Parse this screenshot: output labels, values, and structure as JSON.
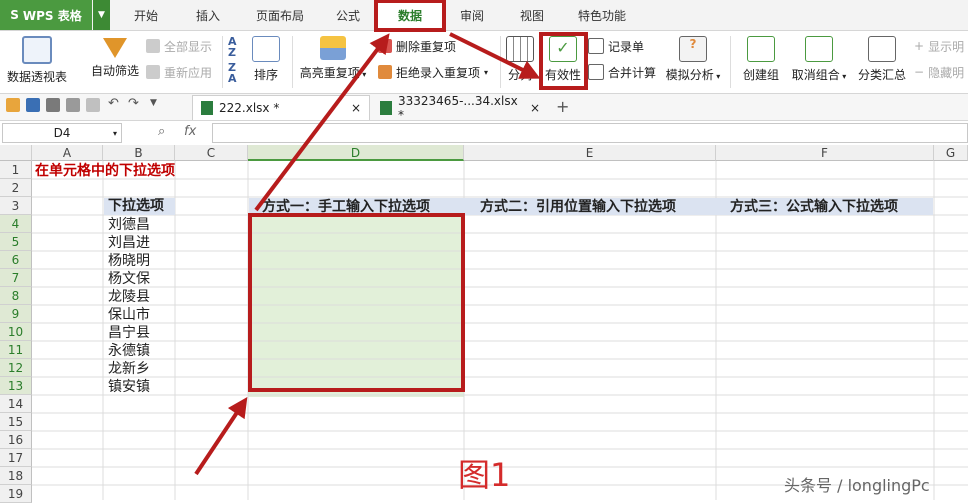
{
  "app": {
    "name": "WPS 表格"
  },
  "tabs": [
    "开始",
    "插入",
    "页面布局",
    "公式",
    "数据",
    "审阅",
    "视图",
    "特色功能"
  ],
  "active_tab": "数据",
  "ribbon": {
    "pivot": "数据透视表",
    "autofilter": "自动筛选",
    "show_all": "全部显示",
    "reapply": "重新应用",
    "sort": "排序",
    "highlight_dup": "高亮重复项",
    "remove_dup": "删除重复项",
    "reject_dup": "拒绝录入重复项",
    "split": "分列",
    "validation": "有效性",
    "record": "记录单",
    "consolidate": "合并计算",
    "whatif": "模拟分析",
    "group": "创建组",
    "ungroup": "取消组合",
    "subtotal": "分类汇总",
    "show_detail": "显示明",
    "hide_detail": "隐藏明"
  },
  "files": [
    {
      "name": "222.xlsx *",
      "close": "×"
    },
    {
      "name": "33323465-...34.xlsx *",
      "close": "×"
    }
  ],
  "add_tab": "+",
  "formula_bar": {
    "cell_ref": "D4",
    "fx": "fx",
    "value": ""
  },
  "columns": [
    "A",
    "B",
    "C",
    "D",
    "E",
    "F",
    "G"
  ],
  "rows": [
    "1",
    "2",
    "3",
    "4",
    "5",
    "6",
    "7",
    "8",
    "9",
    "10",
    "11",
    "12",
    "13",
    "14",
    "15",
    "16",
    "17",
    "18",
    "19"
  ],
  "sheet": {
    "a1": "在单元格中的下拉选项",
    "b3": "下拉选项",
    "b_values": [
      "刘德昌",
      "刘昌进",
      "杨晓明",
      "杨文保",
      "龙陵县",
      "保山市",
      "昌宁县",
      "永德镇",
      "龙新乡",
      "镇安镇"
    ],
    "d3": "方式一：手工输入下拉选项",
    "e3": "方式二：引用位置输入下拉选项",
    "f3": "方式三：公式输入下拉选项"
  },
  "figure_label": "图1",
  "watermark": "头条号 / longlingPc",
  "colors": {
    "accent": "#4b9a40",
    "annotation": "#b71c1c",
    "selection_fill": "#e2f0d9",
    "header_fill": "#dbe3f1",
    "title_text": "#c00000"
  }
}
